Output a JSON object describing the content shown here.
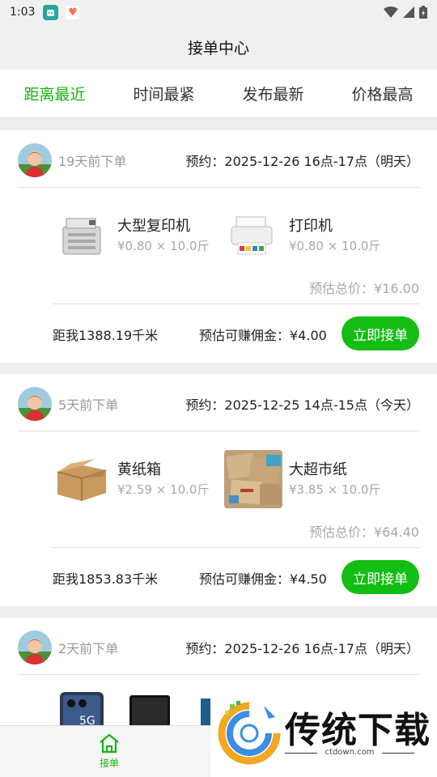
{
  "status_bar": {
    "time": "1:03"
  },
  "header": {
    "title": "接单中心"
  },
  "tabs": [
    {
      "label": "距离最近",
      "active": true
    },
    {
      "label": "时间最紧",
      "active": false
    },
    {
      "label": "发布最新",
      "active": false
    },
    {
      "label": "价格最高",
      "active": false
    }
  ],
  "orders": [
    {
      "ago": "19天前下单",
      "appointment": "预约：2025-12-26 16点-17点（明天）",
      "items": [
        {
          "name": "大型复印机",
          "price": "¥0.80 × 10.0斤",
          "icon": "copier-image"
        },
        {
          "name": "打印机",
          "price": "¥0.80 × 10.0斤",
          "icon": "printer-image"
        }
      ],
      "estimate": "预估总价：¥16.00",
      "distance": "距我1388.19千米",
      "commission": "预估可赚佣金：¥4.00",
      "action": "立即接单"
    },
    {
      "ago": "5天前下单",
      "appointment": "预约：2025-12-25 14点-15点（今天）",
      "items": [
        {
          "name": "黄纸箱",
          "price": "¥2.59 × 10.0斤",
          "icon": "cardboard-box-image"
        },
        {
          "name": "大超市纸",
          "price": "¥3.85 × 10.0斤",
          "icon": "flattened-boxes-image"
        }
      ],
      "estimate": "预估总价：¥64.40",
      "distance": "距我1853.83千米",
      "commission": "预估可赚佣金：¥4.50",
      "action": "立即接单"
    },
    {
      "ago": "2天前下单",
      "appointment": "预约：2025-12-26 16点-17点（明天）"
    }
  ],
  "bottom_nav": {
    "label": "接单",
    "icon": "home-icon"
  },
  "watermark": {
    "title": "传统下载",
    "site": "ctdown.com"
  },
  "colors": {
    "accent": "#14bd14",
    "muted": "#a8a8a8"
  }
}
